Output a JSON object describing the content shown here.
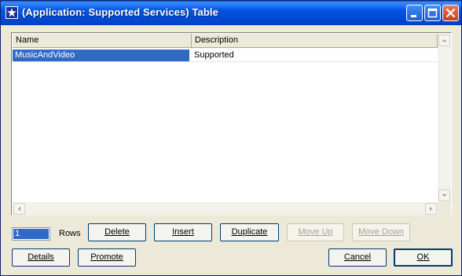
{
  "window": {
    "title": "(Application: Supported Services) Table"
  },
  "table": {
    "columns": [
      "Name",
      "Description"
    ],
    "rows": [
      {
        "name": "MusicAndVideo",
        "description": "Supported"
      }
    ]
  },
  "rows_control": {
    "value": "1",
    "label": "Rows"
  },
  "buttons": {
    "delete": "Delete",
    "insert": "Insert",
    "duplicate": "Duplicate",
    "move_up": "Move Up",
    "move_down": "Move Down",
    "details": "Details",
    "promote": "Promote",
    "cancel": "Cancel",
    "ok": "OK"
  },
  "colors": {
    "titlebar": "#0055e5",
    "selection": "#316ac5",
    "dialog_bg": "#ece9d8"
  },
  "icons": [
    "app-icon",
    "minimize-icon",
    "maximize-icon",
    "close-icon",
    "scroll-up-icon",
    "scroll-down-icon",
    "scroll-left-icon",
    "scroll-right-icon"
  ]
}
